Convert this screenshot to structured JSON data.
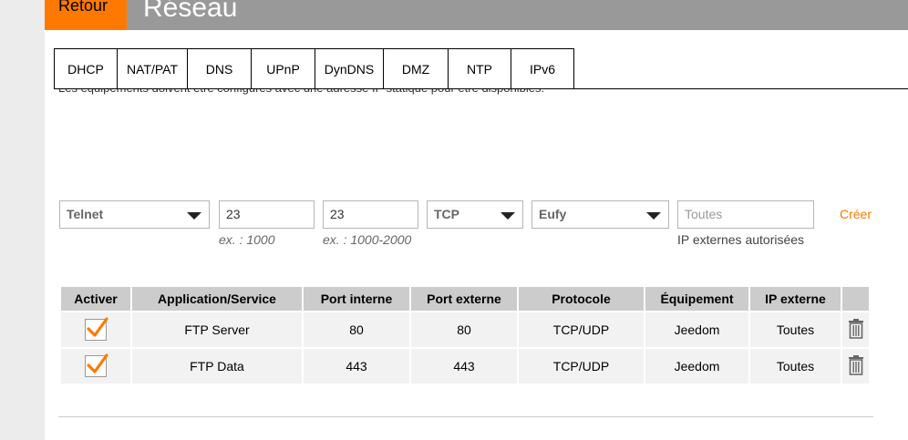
{
  "header": {
    "back_label": "Retour",
    "title": "Réseau",
    "accent_color": "#ff7900",
    "bar_color": "#999999"
  },
  "tabs": [
    "DHCP",
    "NAT/PAT",
    "DNS",
    "UPnP",
    "DynDNS",
    "DMZ",
    "NTP",
    "IPv6"
  ],
  "note": "Les équipements doivent être configurés avec une adresse IP statique pour être disponibles.",
  "form": {
    "service_select": "Telnet",
    "internal_port": "23",
    "internal_port_hint": "ex. : 1000",
    "external_port": "23",
    "external_port_hint": "ex. : 1000-2000",
    "protocol_select": "TCP",
    "device_select": "Eufy",
    "external_ip_placeholder": "Toutes",
    "external_ip_hint": "IP externes autorisées",
    "create_label": "Créer"
  },
  "table": {
    "headers": [
      "Activer",
      "Application/Service",
      "Port interne",
      "Port externe",
      "Protocole",
      "Équipement",
      "IP externe",
      ""
    ],
    "rows": [
      {
        "active": true,
        "service": "FTP Server",
        "internal": "80",
        "external": "80",
        "protocol": "TCP/UDP",
        "device": "Jeedom",
        "ip": "Toutes"
      },
      {
        "active": true,
        "service": "FTP Data",
        "internal": "443",
        "external": "443",
        "protocol": "TCP/UDP",
        "device": "Jeedom",
        "ip": "Toutes"
      }
    ]
  },
  "icons": {
    "checkbox": "checkmark-icon",
    "delete": "trash-icon",
    "dropdown": "caret-down-icon"
  }
}
